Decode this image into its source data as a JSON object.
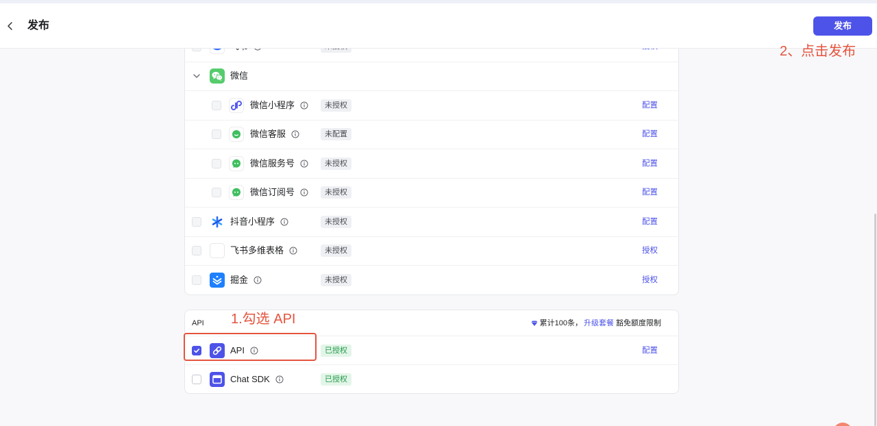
{
  "header": {
    "back_icon": "chevron-left-icon",
    "title": "发布",
    "publish_label": "发布"
  },
  "annotations": {
    "publish_hint": "2、点击发布",
    "api_hint": "1.勾选 API",
    "color": "#e5533d"
  },
  "theme": {
    "primary": "#4d53e8",
    "neutral_text": "#4b4d55",
    "neutral_bg": "#eff0f3",
    "success_text": "#229a4a",
    "success_bg": "#e3f5e8"
  },
  "channels": {
    "rows": [
      {
        "label": "飞书",
        "icon": "feishu-icon",
        "status": "未授权",
        "action": "授权",
        "checked": false
      },
      {
        "label": "微信",
        "icon": "wechat-icon",
        "expanded": true
      },
      {
        "label": "微信小程序",
        "icon": "mini-program-icon",
        "status": "未授权",
        "action": "配置",
        "checked": false
      },
      {
        "label": "微信客服",
        "icon": "customer-service-icon",
        "status": "未配置",
        "action": "配置",
        "checked": false
      },
      {
        "label": "微信服务号",
        "icon": "service-account-icon",
        "status": "未授权",
        "action": "配置",
        "checked": false
      },
      {
        "label": "微信订阅号",
        "icon": "subscription-account-icon",
        "status": "未授权",
        "action": "配置",
        "checked": false
      },
      {
        "label": "抖音小程序",
        "icon": "douyin-mini-program-icon",
        "status": "未授权",
        "action": "配置",
        "checked": false
      },
      {
        "label": "飞书多维表格",
        "icon": "feishu-bitable-icon",
        "status": "未授权",
        "action": "授权",
        "checked": false
      },
      {
        "label": "掘金",
        "icon": "juejin-icon",
        "status": "未授权",
        "action": "授权",
        "checked": false
      }
    ]
  },
  "api_section": {
    "title": "API",
    "quota_icon": "diamond-icon",
    "quota_text": "累计100条，",
    "upgrade_link": "升级套餐",
    "quota_suffix": "豁免额度限制",
    "rows": [
      {
        "label": "API",
        "icon": "api-link-icon",
        "status": "已授权",
        "action": "配置",
        "checked": true
      },
      {
        "label": "Chat SDK",
        "icon": "chat-sdk-icon",
        "status": "已授权",
        "checked": false
      }
    ]
  }
}
